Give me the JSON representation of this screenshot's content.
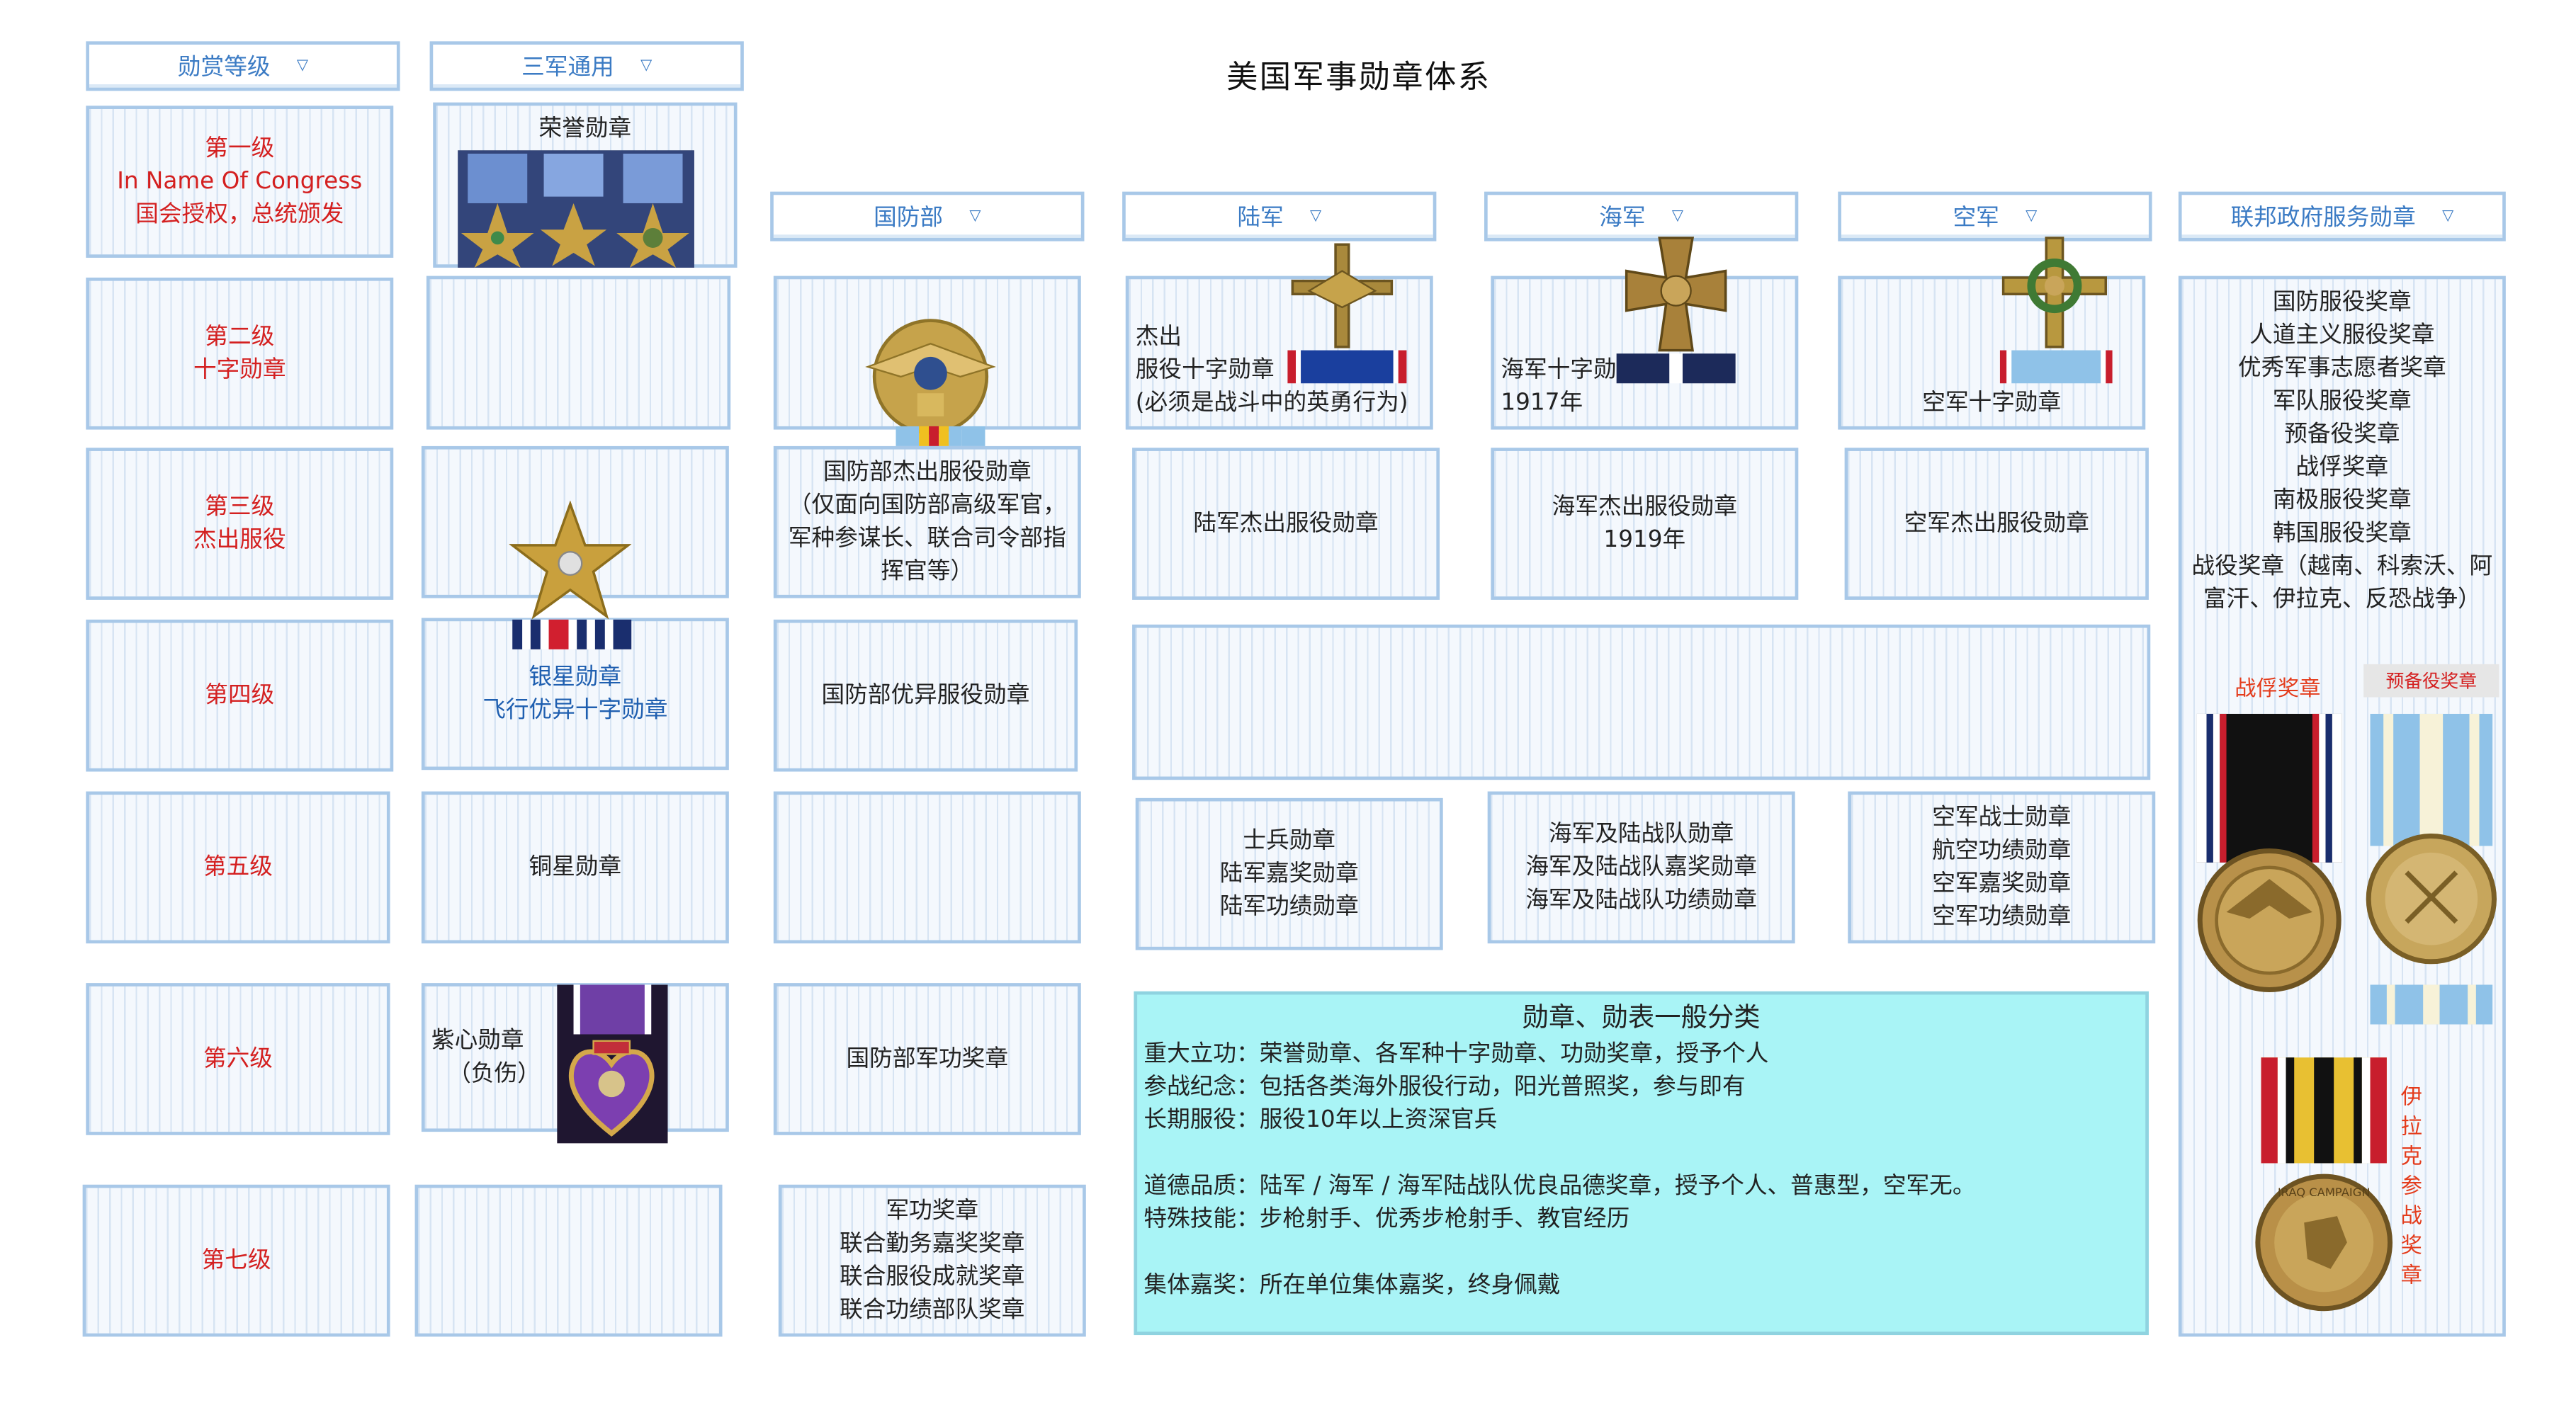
{
  "title": "美国军事勋章体系",
  "headers": {
    "rank": "勋赏等级",
    "joint": "三军通用",
    "dod": "国防部",
    "army": "陆军",
    "navy": "海军",
    "airforce": "空军",
    "federal": "联邦政府服务勋章"
  },
  "levels": {
    "l1": {
      "name": "第一级",
      "en": "In Name Of Congress",
      "note": "国会授权，总统颁发"
    },
    "l2": {
      "name": "第二级",
      "sub": "十字勋章"
    },
    "l3": {
      "name": "第三级",
      "sub": "杰出服役"
    },
    "l4": {
      "name": "第四级"
    },
    "l5": {
      "name": "第五级"
    },
    "l6": {
      "name": "第六级"
    },
    "l7": {
      "name": "第七级"
    }
  },
  "joint": {
    "l1": "荣誉勋章",
    "l4a": "银星勋章",
    "l4b": "飞行优异十字勋章",
    "l5": "铜星勋章",
    "l6a": "紫心勋章",
    "l6b": "（负伤）"
  },
  "dod": {
    "l3a": "国防部杰出服役勋章",
    "l3b": "（仅面向国防部高级军官，",
    "l3c": "军种参谋长、联合司令部指",
    "l3d": "挥官等）",
    "l4": "国防部优异服役勋章",
    "l6": "国防部军功奖章",
    "l7a": "军功奖章",
    "l7b": "联合勤务嘉奖奖章",
    "l7c": "联合服役成就奖章",
    "l7d": "联合功绩部队奖章"
  },
  "army": {
    "l2a": "杰出",
    "l2b": "服役十字勋章",
    "l2c": "(必须是战斗中的英勇行为)",
    "l3": "陆军杰出服役勋章",
    "l5a": "士兵勋章",
    "l5b": "陆军嘉奖勋章",
    "l5c": "陆军功绩勋章"
  },
  "navy": {
    "l2a": "海军十字勋",
    "l2b": "1917年",
    "l3a": "海军杰出服役勋章",
    "l3b": "1919年",
    "l5a": "海军及陆战队勋章",
    "l5b": "海军及陆战队嘉奖勋章",
    "l5c": "海军及陆战队功绩勋章"
  },
  "airforce": {
    "l2": "空军十字勋章",
    "l3": "空军杰出服役勋章",
    "l5a": "空军战士勋章",
    "l5b": "航空功绩勋章",
    "l5c": "空军嘉奖勋章",
    "l5d": "空军功绩勋章"
  },
  "federal": {
    "items": [
      "国防服役奖章",
      "人道主义服役奖章",
      "优秀军事志愿者奖章",
      "军队服役奖章",
      "预备役奖章",
      "战俘奖章",
      "南极服役奖章",
      "韩国服役奖章"
    ],
    "campaign1": "战役奖章（越南、科索沃、阿",
    "campaign2": "富汗、伊拉克、反恐战争）",
    "pow": "战俘奖章",
    "reserve": "预备役奖章",
    "iraq": [
      "伊",
      "拉",
      "克",
      "参",
      "战",
      "奖",
      "章"
    ],
    "iraq_medal_text": "IRAQ CAMPAIGN"
  },
  "summary": {
    "heading": "勋章、勋表一般分类",
    "lines": [
      "重大立功：荣誉勋章、各军种十字勋章、功勋奖章，授予个人",
      "参战纪念：包括各类海外服役行动，阳光普照奖，参与即有",
      "长期服役：服役10年以上资深官兵",
      "",
      "道德品质：陆军 / 海军 / 海军陆战队优良品德奖章，授予个人、普惠型，空军无。",
      "特殊技能：步枪射手、优秀步枪射手、教官经历",
      "",
      "集体嘉奖：所在单位集体嘉奖，终身佩戴"
    ]
  },
  "colors": {
    "header_text": "#3b7bc4",
    "level_text": "#d42020",
    "border": "#a8c8e8",
    "summary_bg": "#a9f4f6"
  },
  "dropdown_icon": "chevron-down-icon"
}
